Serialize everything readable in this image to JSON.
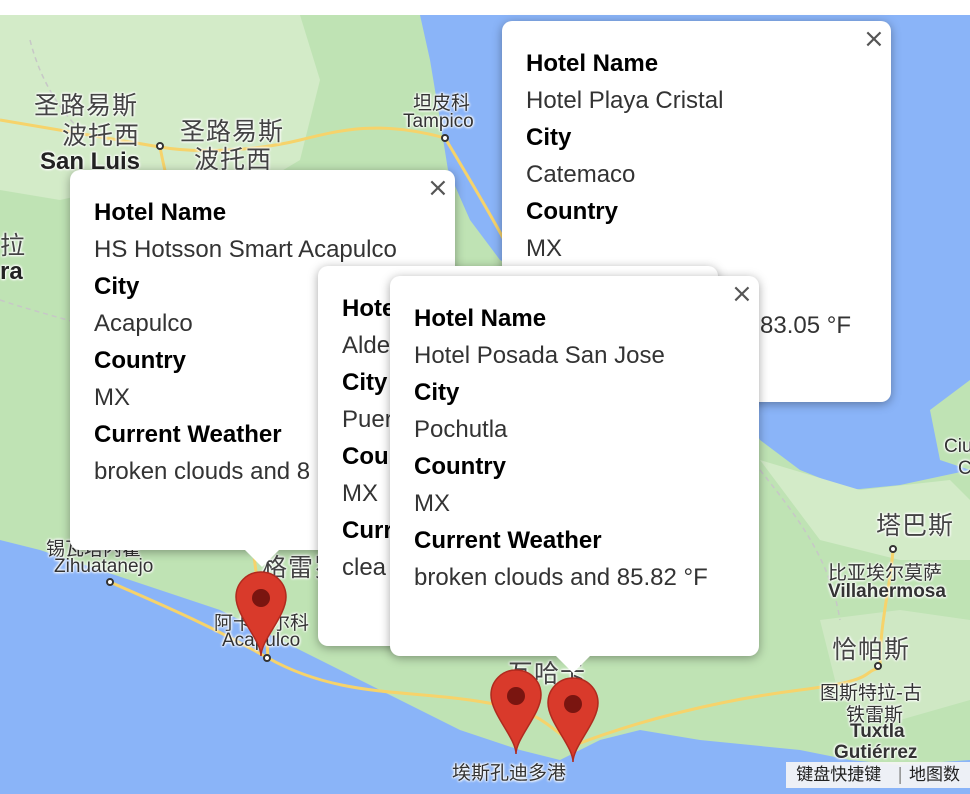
{
  "map": {
    "labels": {
      "san_luis_zh_1": "圣路易斯",
      "san_luis_zh_2": "波托西",
      "san_luis_zh_3": "圣路易斯",
      "san_luis_zh_4": "波托西",
      "san_luis_en": "San Luis",
      "tampico_zh": "坦皮科",
      "tampico_en": "Tampico",
      "left_zh": "拉",
      "left_en": "ra",
      "zihuatanejo_zh": "锡瓦塔内霍",
      "zihuatanejo_en": "Zihuatanejo",
      "acapulco_zh": "阿卡普尔科",
      "acapulco_en": "Acapulco",
      "guerrero_zh": "格雷罗",
      "oaxaca_zh": "瓦哈卡",
      "puerto_escondido_zh": "埃斯孔迪多港",
      "tabasco_zh": "塔巴斯",
      "villahermosa_zh": "比亚埃尔莫萨",
      "villahermosa_en": "Villahermosa",
      "chiapas_zh": "恰帕斯",
      "tuxtla_zh_1": "图斯特拉-古",
      "tuxtla_zh_2": "铁雷斯",
      "tuxtla_en": "Tuxtla",
      "gutierrez_en": "Gutiérrez",
      "ciudad_en_1": "Ciu",
      "ciudad_en_2": "C"
    },
    "attribution": {
      "shortcuts": "键盘快捷键",
      "map_data": "地图数"
    },
    "colors": {
      "water": "#8ab4f8",
      "land": "#bfe3b4",
      "land_light": "#dfefd8",
      "road": "#f6d36b",
      "marker": "#d93a2b"
    }
  },
  "popups": {
    "p1": {
      "hotel_name_label": "Hotel Name",
      "hotel_name": "Hotel Playa Cristal",
      "city_label": "City",
      "city": "Catemaco",
      "country_label": "Country",
      "country": "MX",
      "weather_fragment": "83.05 °F",
      "close": "×"
    },
    "p2": {
      "hotel_name_label": "Hotel Name",
      "hotel_name": "HS Hotsson Smart Acapulco",
      "city_label": "City",
      "city": "Acapulco",
      "country_label": "Country",
      "country": "MX",
      "weather_label": "Current Weather",
      "weather": "broken clouds and 8",
      "close": "×"
    },
    "p3": {
      "hotel_name_label": "Hote",
      "hotel_name": "Alde",
      "city_label": "City",
      "city": "Puer",
      "country_label": "Cou",
      "country": "MX",
      "weather_label": "Curr",
      "weather": "clea"
    },
    "p4": {
      "hotel_name_label": "Hotel Name",
      "hotel_name": "Hotel Posada San Jose",
      "city_label": "City",
      "city": "Pochutla",
      "country_label": "Country",
      "country": "MX",
      "weather_label": "Current Weather",
      "weather": "broken clouds and 85.82 °F",
      "close": "×"
    }
  }
}
